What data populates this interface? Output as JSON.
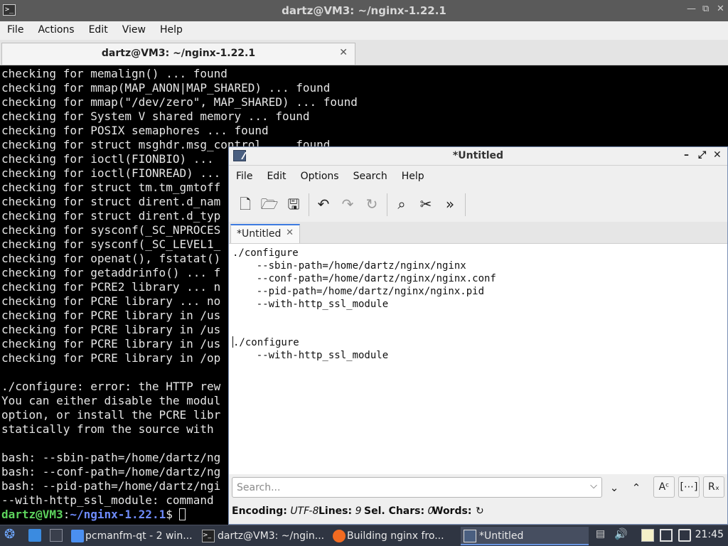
{
  "terminal": {
    "title": "dartz@VM3: ~/nginx-1.22.1",
    "menu": [
      "File",
      "Actions",
      "Edit",
      "View",
      "Help"
    ],
    "tab_label": "dartz@VM3: ~/nginx-1.22.1",
    "lines": [
      "checking for memalign() ... found",
      "checking for mmap(MAP_ANON|MAP_SHARED) ... found",
      "checking for mmap(\"/dev/zero\", MAP_SHARED) ... found",
      "checking for System V shared memory ... found",
      "checking for POSIX semaphores ... found",
      "checking for struct msghdr.msg_control ... found",
      "checking for ioctl(FIONBIO) ...",
      "checking for ioctl(FIONREAD) ...",
      "checking for struct tm.tm_gmtoff",
      "checking for struct dirent.d_nam",
      "checking for struct dirent.d_typ",
      "checking for sysconf(_SC_NPROCES",
      "checking for sysconf(_SC_LEVEL1_",
      "checking for openat(), fstatat()",
      "checking for getaddrinfo() ... f",
      "checking for PCRE2 library ... n",
      "checking for PCRE library ... no",
      "checking for PCRE library in /us",
      "checking for PCRE library in /us",
      "checking for PCRE library in /us",
      "checking for PCRE library in /op",
      "",
      "./configure: error: the HTTP rew",
      "You can either disable the modul",
      "option, or install the PCRE libr",
      "statically from the source with",
      "",
      "bash: --sbin-path=/home/dartz/ng",
      "bash: --conf-path=/home/dartz/ng",
      "bash: --pid-path=/home/dartz/ngi",
      "--with-http_ssl_module: command"
    ],
    "prompt_user": "dartz@VM3",
    "prompt_path": "~/nginx-1.22.1",
    "prompt_sep": ":",
    "prompt_end": "$ "
  },
  "editor": {
    "title": "*Untitled",
    "menu": [
      "File",
      "Edit",
      "Options",
      "Search",
      "Help"
    ],
    "tab_label": "*Untitled",
    "lines": [
      "./configure",
      "    --sbin-path=/home/dartz/nginx/nginx",
      "    --conf-path=/home/dartz/nginx/nginx.conf",
      "    --pid-path=/home/dartz/nginx/nginx.pid",
      "    --with-http_ssl_module",
      "",
      "",
      "./configure",
      "    --with-http_ssl_module"
    ],
    "search_placeholder": "Search...",
    "status": {
      "encoding_label": "Encoding:",
      "encoding_value": "UTF-8",
      "lines_label": "Lines:",
      "lines_value": "9",
      "sel_label": "Sel. Chars:",
      "sel_value": "0",
      "words_label": "Words:"
    }
  },
  "taskbar": {
    "tasks": [
      {
        "label": "pcmanfm-qt - 2 win..."
      },
      {
        "label": "dartz@VM3: ~/ngin..."
      },
      {
        "label": "Building nginx fro..."
      },
      {
        "label": "*Untitled"
      }
    ],
    "clock": "21:45"
  }
}
